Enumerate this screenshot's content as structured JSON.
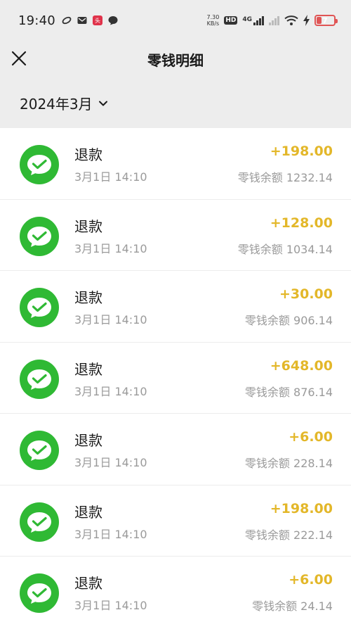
{
  "status_bar": {
    "time": "19:40",
    "net_speed_value": "7.30",
    "net_speed_unit": "KB/s",
    "hd_label": "HD",
    "network_label": "4G",
    "battery_level": "7",
    "icons": [
      "sync-icon",
      "mail-icon",
      "app-badge-icon",
      "chat-icon",
      "wifi-icon",
      "charging-icon"
    ]
  },
  "nav": {
    "title": "零钱明细"
  },
  "filter": {
    "month": "2024年3月"
  },
  "colors": {
    "accent_amount": "#e3b729",
    "avatar_green": "#2fb934",
    "header_bg": "#ededed"
  },
  "transactions": [
    {
      "title": "退款",
      "time": "3月1日 14:10",
      "amount": "+198.00",
      "balance": "零钱余额 1232.14"
    },
    {
      "title": "退款",
      "time": "3月1日 14:10",
      "amount": "+128.00",
      "balance": "零钱余额 1034.14"
    },
    {
      "title": "退款",
      "time": "3月1日 14:10",
      "amount": "+30.00",
      "balance": "零钱余额 906.14"
    },
    {
      "title": "退款",
      "time": "3月1日 14:10",
      "amount": "+648.00",
      "balance": "零钱余额 876.14"
    },
    {
      "title": "退款",
      "time": "3月1日 14:10",
      "amount": "+6.00",
      "balance": "零钱余额 228.14"
    },
    {
      "title": "退款",
      "time": "3月1日 14:10",
      "amount": "+198.00",
      "balance": "零钱余额 222.14"
    },
    {
      "title": "退款",
      "time": "3月1日 14:10",
      "amount": "+6.00",
      "balance": "零钱余额 24.14"
    }
  ]
}
